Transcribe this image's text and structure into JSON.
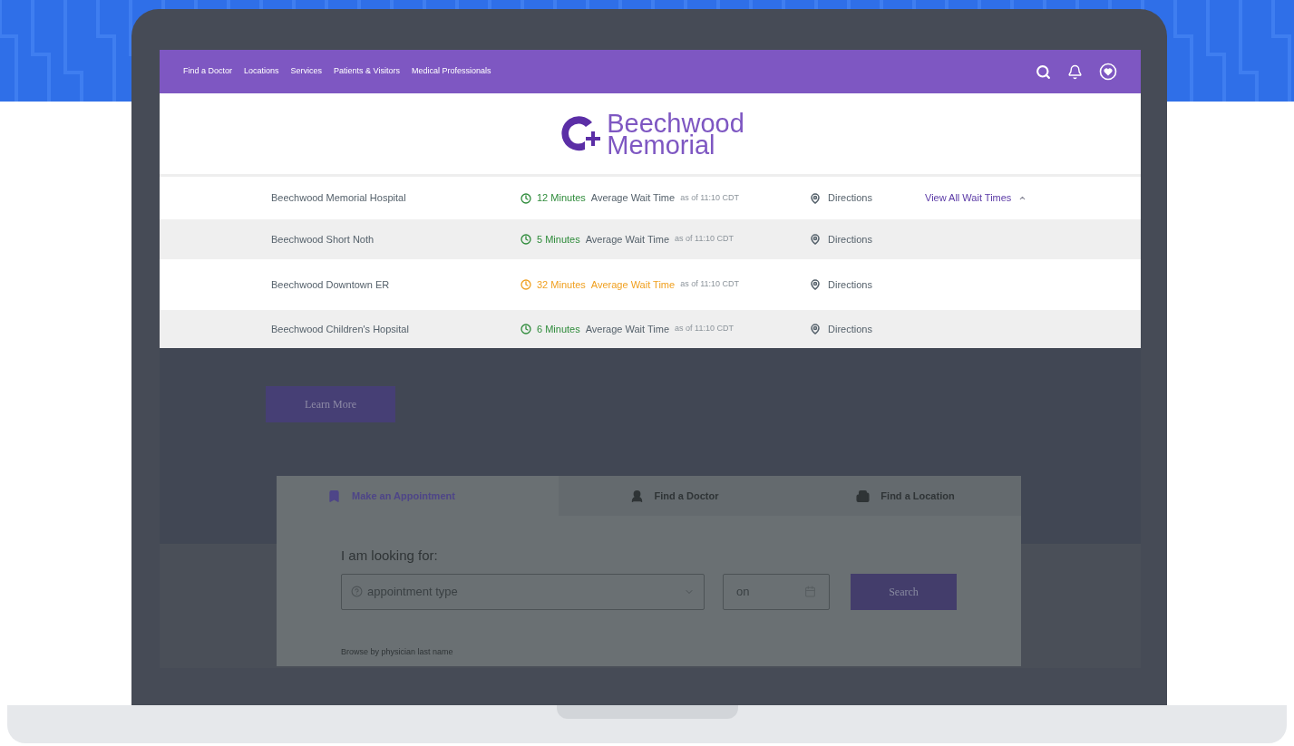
{
  "nav": {
    "links": [
      {
        "label": "Find a Doctor"
      },
      {
        "label": "Locations"
      },
      {
        "label": "Services"
      },
      {
        "label": "Patients & Visitors"
      },
      {
        "label": "Medical Professionals"
      }
    ]
  },
  "logo": {
    "lines": [
      "Beechwood",
      "Memorial"
    ]
  },
  "wait_times": {
    "view_all": {
      "label": "View All Wait Times",
      "expanded": true
    },
    "rows": [
      {
        "name": "Beechwood Memorial Hospital",
        "kind": "normal",
        "minutes": "12 Minutes",
        "label": "Average Wait Time",
        "as_of": "as of 11:10 CDT",
        "directions": "Directions"
      },
      {
        "name": "Beechwood Short Noth",
        "kind": "normal",
        "minutes": "5 Minutes",
        "label": "Average Wait Time",
        "as_of": "as of 11:10 CDT",
        "directions": "Directions"
      },
      {
        "name": "Beechwood Downtown ER",
        "kind": "long",
        "minutes": "32 Minutes",
        "label": "Average Wait Time",
        "as_of": "as of 11:10 CDT",
        "directions": "Directions"
      },
      {
        "name": "Beechwood Children's Hopsital",
        "kind": "normal",
        "minutes": "6 Minutes",
        "label": "Average Wait Time",
        "as_of": "as of 11:10 CDT",
        "directions": "Directions"
      }
    ]
  },
  "hero": {
    "button": "Learn More"
  },
  "finder": {
    "tabs": [
      {
        "label": "Make an Appointment",
        "kind": "appointment",
        "selected": true
      },
      {
        "label": "Find a Doctor",
        "kind": "doctor",
        "selected": false
      },
      {
        "label": "Find a Location",
        "kind": "location",
        "selected": false
      }
    ],
    "prompt": "I am looking for:",
    "type_select": {
      "placeholder": "appointment type"
    },
    "date_field": {
      "placeholder": "on"
    },
    "search_button": "Search",
    "browse": "Browse by physician last name"
  }
}
